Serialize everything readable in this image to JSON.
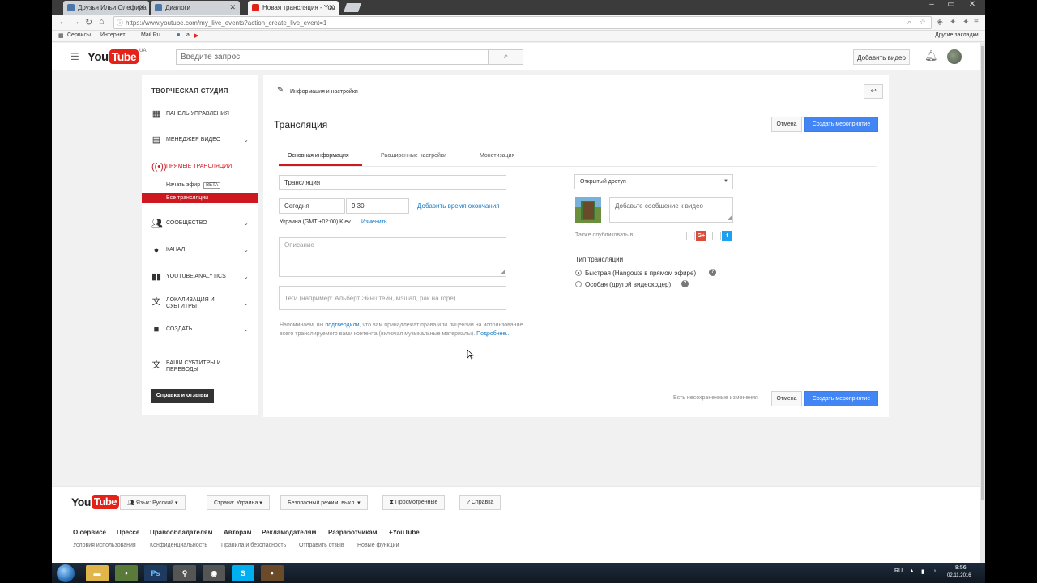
{
  "browser": {
    "tabs": [
      {
        "label": "Друзья Ильи Олефира"
      },
      {
        "label": "Диалоги"
      },
      {
        "label": "Новая трансляция - You"
      }
    ],
    "url": "https://www.youtube.com/my_live_events?action_create_live_event=1",
    "bookmarks": {
      "services": "Сервисы",
      "internet": "Интернет",
      "mailru": "Mail.Ru",
      "a": "a",
      "other": "Другие закладки"
    }
  },
  "header": {
    "logo_you": "You",
    "logo_tube": "Tube",
    "region": "UA",
    "search_placeholder": "Введите запрос",
    "upload_label": "Добавить видео"
  },
  "sidebar": {
    "title": "ТВОРЧЕСКАЯ СТУДИЯ",
    "items": [
      {
        "label": "ПАНЕЛЬ УПРАВЛЕНИЯ",
        "icon": "dashboard-icon"
      },
      {
        "label": "МЕНЕДЖЕР ВИДЕО",
        "icon": "video-manager-icon"
      },
      {
        "label": "ПРЯМЫЕ ТРАНСЛЯЦИИ",
        "icon": "live-icon"
      },
      {
        "label": "СООБЩЕСТВО",
        "icon": "community-icon"
      },
      {
        "label": "КАНАЛ",
        "icon": "channel-icon"
      },
      {
        "label": "YOUTUBE ANALYTICS",
        "icon": "analytics-icon"
      },
      {
        "label": "ЛОКАЛИЗАЦИЯ И СУБТИТРЫ",
        "icon": "translate-icon"
      },
      {
        "label": "СОЗДАТЬ",
        "icon": "create-icon"
      },
      {
        "label": "ВАШИ СУБТИТРЫ И ПЕРЕВОДЫ",
        "icon": "subtitles-icon"
      }
    ],
    "sub_start": "Начать эфир",
    "sub_beta": "BETA",
    "sub_all": "Все трансляции",
    "help_button": "Справка и отзывы"
  },
  "panel": {
    "header_title": "Информация и настройки",
    "title": "Трансляция",
    "cancel": "Отмена",
    "create": "Создать мероприятие",
    "tabs": [
      "Основная информация",
      "Расширенные настройки",
      "Монетизация"
    ],
    "name_value": "Трансляция",
    "date_value": "Сегодня",
    "time_value": "9:30",
    "add_end_time": "Добавить время окончания",
    "timezone": "Украина (GMT +02:00) Kiev",
    "change": "Изменить",
    "description_placeholder": "Описание",
    "tags_placeholder": "Теги (например: Альберт Эйнштейн, мэшап, рак на горе)",
    "notice_1": "Напоминаем, вы ",
    "notice_link": "подтвердили",
    "notice_2": ", что вам принадлежат права или лицензии на использование",
    "notice_3": "всего транслируемого вами контента (включая музыкальные материалы).",
    "notice_more": "Подробнее...",
    "privacy": "Открытый доступ",
    "message_placeholder": "Добавьте сообщение к видео",
    "also_publish": "Также опубликовать в",
    "stream_type_title": "Тип трансляции",
    "type_quick": "Быстрая (Hangouts в прямом эфире)",
    "type_custom": "Особая (другой видеокодер)",
    "unsaved": "Есть несохраненные изменения"
  },
  "footer": {
    "logo_you": "You",
    "logo_tube": "Tube",
    "language": "Язык: Русский",
    "country": "Страна: Украина",
    "safety": "Безопасный режим: выкл.",
    "history": "Просмотренные",
    "help": "Справка",
    "links": [
      "О сервисе",
      "Прессе",
      "Правообладателям",
      "Авторам",
      "Рекламодателям",
      "Разработчикам",
      "+YouTube"
    ],
    "links2": [
      "Условия использования",
      "Конфиденциальность",
      "Правила и безопасность",
      "Отправить отзыв",
      "Новые функции"
    ]
  },
  "taskbar": {
    "lang": "RU",
    "time": "8:56",
    "date": "02.11.2016"
  },
  "colors": {
    "accent_red": "#cc181e",
    "primary_blue": "#4285f4",
    "link_blue": "#167ac6"
  }
}
